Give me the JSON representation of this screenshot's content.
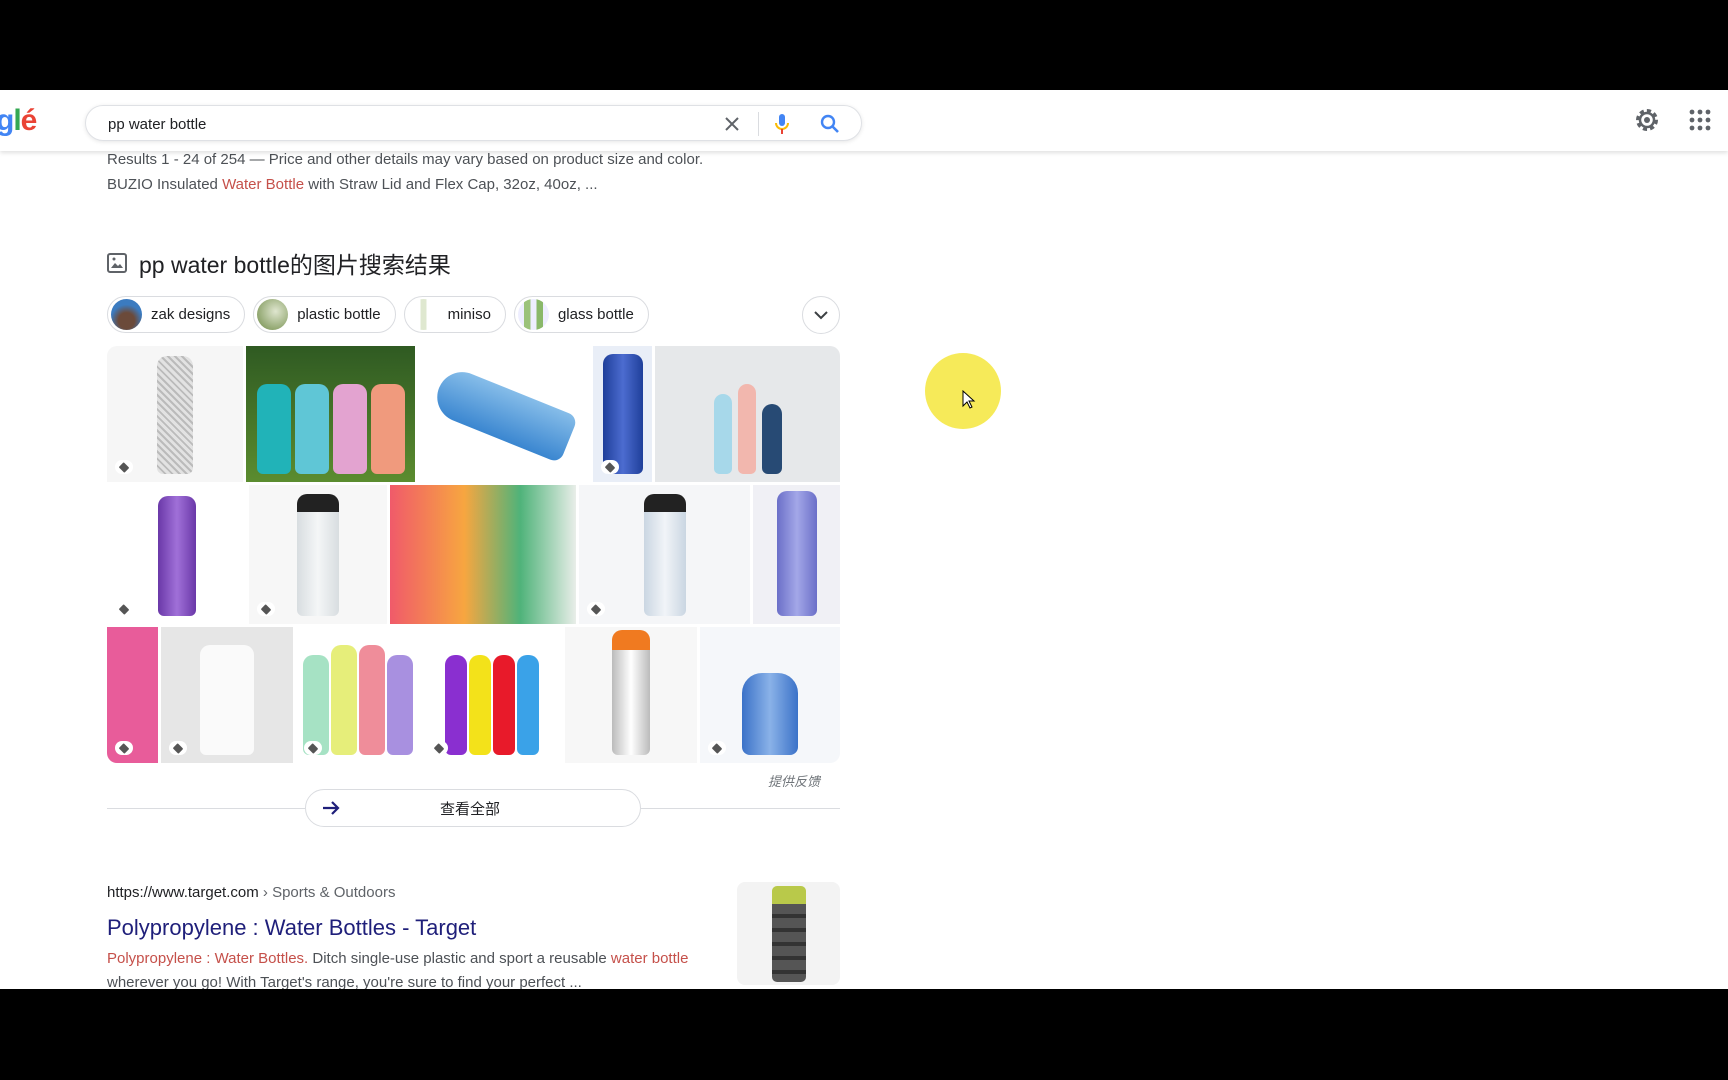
{
  "search": {
    "query": "pp water bottle",
    "clear_icon": "close-icon",
    "voice_icon": "microphone-icon",
    "search_icon": "search-icon"
  },
  "header": {
    "logo": "Google",
    "settings_icon": "gear-icon",
    "apps_icon": "apps-grid-icon"
  },
  "results_summary": "Results 1 - 24 of 254 — Price and other details may vary based on product size and color.",
  "snippet_line": {
    "pre": "BUZIO Insulated ",
    "highlight": "Water Bottle",
    "post": " with Straw Lid and Flex Cap, 32oz, 40oz, ..."
  },
  "images_section": {
    "heading": "pp water bottle的图片搜索结果",
    "chips": [
      {
        "label": "zak designs"
      },
      {
        "label": "plastic bottle"
      },
      {
        "label": "miniso"
      },
      {
        "label": "glass bottle"
      }
    ],
    "feedback": "提供反馈",
    "view_all": "查看全部"
  },
  "result": {
    "url": "https://www.target.com",
    "breadcrumb": " › Sports & Outdoors",
    "title": "Polypropylene : Water Bottles - Target",
    "snippet_hl1": "Polypropylene : Water Bottles.",
    "snippet_mid": " Ditch single-use plastic and sport a reusable ",
    "snippet_hl2": "water bottle",
    "snippet_line2": "wherever you go! With Target's range, you're sure to find your perfect ..."
  },
  "colors": {
    "highlight": "#c5504a",
    "link": "#1f1f7a",
    "accent_blue": "#4285f4"
  }
}
